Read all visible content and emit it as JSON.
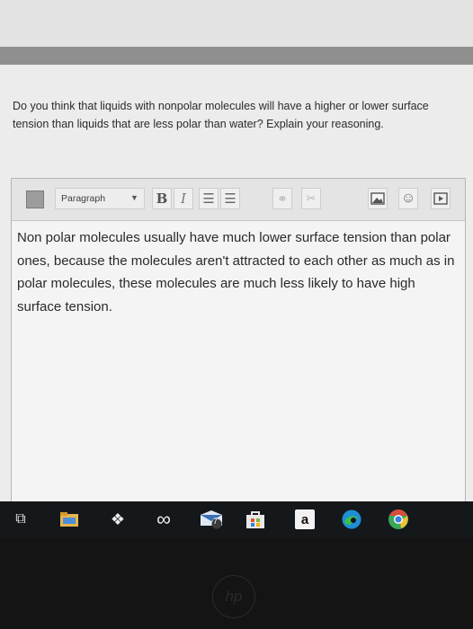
{
  "question": {
    "text": "Do you think that liquids with nonpolar molecules will have a higher or lower surface tension than liquids that are less polar than water? Explain your reasoning."
  },
  "editor": {
    "toolbar": {
      "format_label": "Paragraph",
      "bold_label": "B",
      "italic_label": "I"
    },
    "answer_text": "Non polar molecules usually have much lower surface tension than polar ones, because the molecules aren't attracted to each other as much as in polar molecules, these molecules are much less likely to have high surface tension."
  },
  "taskbar": {
    "mail_badge": "7",
    "amazon_label": "a"
  },
  "icons": {
    "toolbar": [
      "grid-icon",
      "dropdown-caret-icon",
      "bullet-list-icon",
      "numbered-list-icon",
      "link-icon",
      "unlink-icon",
      "image-icon",
      "emoji-icon",
      "media-icon"
    ],
    "taskbar": [
      "task-view-icon",
      "file-explorer-icon",
      "dropbox-icon",
      "infinity-icon",
      "mail-icon",
      "store-icon",
      "amazon-icon",
      "edge-icon",
      "chrome-icon"
    ]
  },
  "colors": {
    "edge_blue": "#1f8fd6",
    "edge_green": "#3fbf4a",
    "chrome_red": "#d84c3c",
    "chrome_yellow": "#f3c234",
    "chrome_green": "#3aa757",
    "chrome_blue": "#3b7de0"
  }
}
